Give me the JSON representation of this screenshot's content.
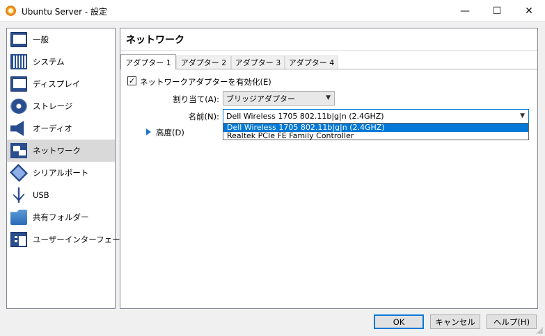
{
  "window": {
    "title": "Ubuntu Server - 設定",
    "minimize_glyph": "—",
    "maximize_glyph": "☐",
    "close_glyph": "✕"
  },
  "sidebar": {
    "items": [
      {
        "label": "一般",
        "icon": "general-icon"
      },
      {
        "label": "システム",
        "icon": "system-icon"
      },
      {
        "label": "ディスプレイ",
        "icon": "display-icon"
      },
      {
        "label": "ストレージ",
        "icon": "storage-icon"
      },
      {
        "label": "オーディオ",
        "icon": "audio-icon"
      },
      {
        "label": "ネットワーク",
        "icon": "network-icon",
        "selected": true
      },
      {
        "label": "シリアルポート",
        "icon": "serial-port-icon"
      },
      {
        "label": "USB",
        "icon": "usb-icon"
      },
      {
        "label": "共有フォルダー",
        "icon": "shared-folder-icon"
      },
      {
        "label": "ユーザーインターフェース",
        "icon": "user-interface-icon"
      }
    ]
  },
  "main": {
    "title": "ネットワーク",
    "tabs": [
      {
        "label": "アダプター 1",
        "active": true
      },
      {
        "label": "アダプター 2"
      },
      {
        "label": "アダプター 3"
      },
      {
        "label": "アダプター 4"
      }
    ],
    "enable_checkbox": {
      "label": "ネットワークアダプターを有効化(E)",
      "checked": true,
      "mark": "✓"
    },
    "attached_to": {
      "label": "割り当て(A):",
      "value": "ブリッジアダプター"
    },
    "name": {
      "label": "名前(N):",
      "value": "Dell Wireless 1705 802.11b|g|n (2.4GHZ)",
      "options": [
        "Dell Wireless 1705 802.11b|g|n (2.4GHZ)",
        "Realtek PCIe FE Family Controller"
      ]
    },
    "advanced": {
      "label": "高度(D)"
    }
  },
  "buttons": {
    "ok": "OK",
    "cancel": "キャンセル",
    "help": "ヘルプ(H)"
  },
  "colors": {
    "accent": "#0078d7",
    "selected_item": "#d9d9d9",
    "icon_blue": "#2a4d8e"
  }
}
